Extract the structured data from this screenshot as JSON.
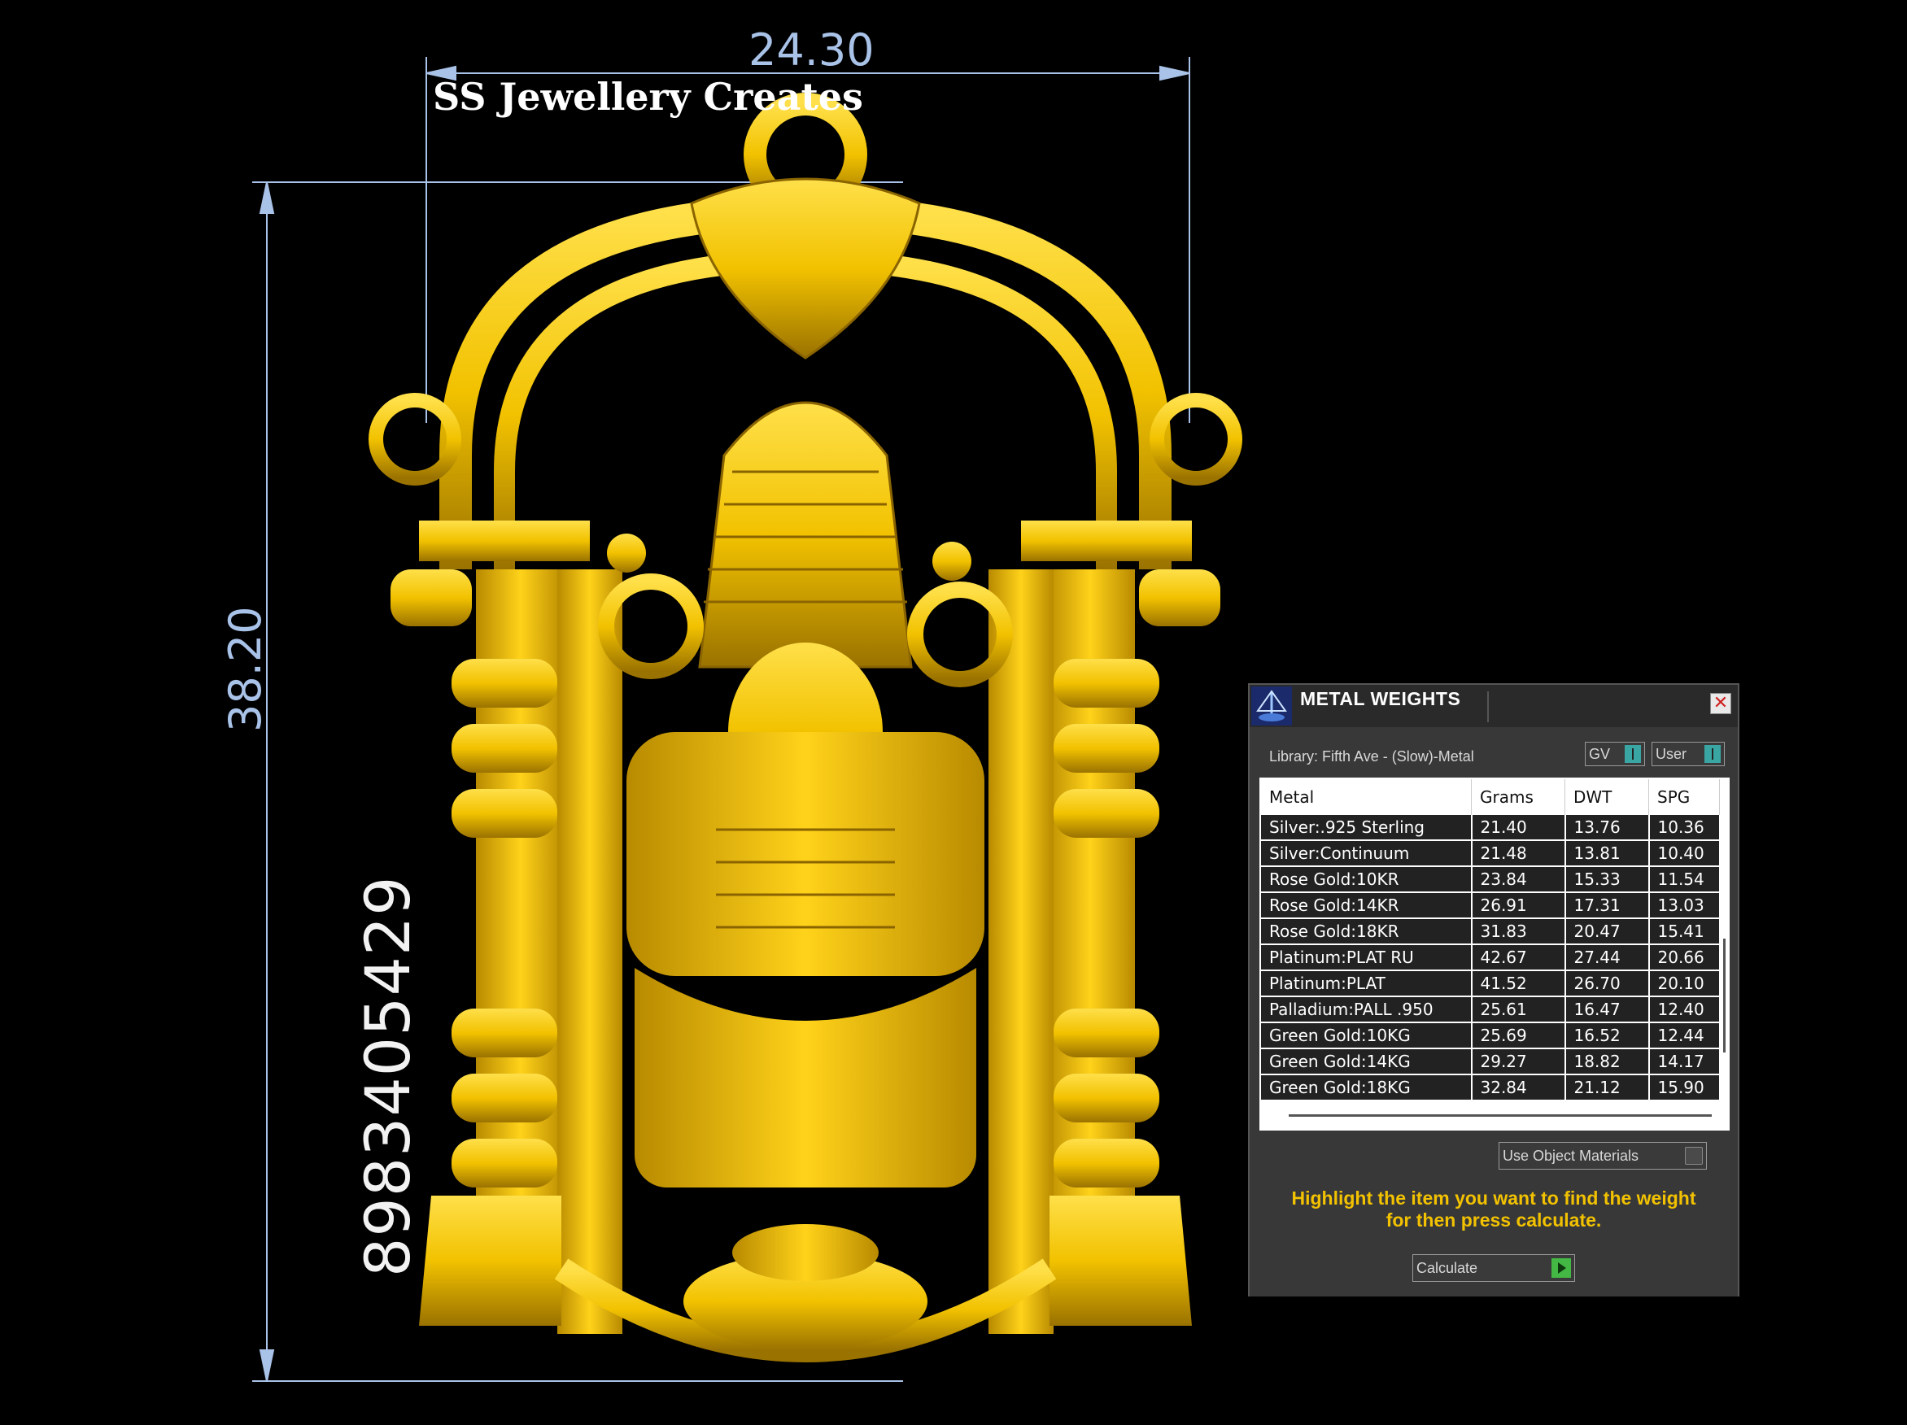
{
  "viewport": {
    "dimension_width": "24.30",
    "dimension_height": "38.20",
    "phone": "8983405429",
    "brand": "SS Jewellery Creates",
    "model_color": "#f2c200",
    "dimension_color": "#a9c2e8"
  },
  "panel": {
    "title": "METAL WEIGHTS",
    "close_icon": "close-icon",
    "library": "Library: Fifth Ave - (Slow)-Metal",
    "toggles": [
      {
        "label": "GV"
      },
      {
        "label": "User"
      }
    ],
    "table": {
      "headers": [
        "Metal",
        "Grams",
        "DWT",
        "SPG"
      ],
      "rows": [
        [
          "Silver:.925 Sterling",
          "21.40",
          "13.76",
          "10.36"
        ],
        [
          "Silver:Continuum",
          "21.48",
          "13.81",
          "10.40"
        ],
        [
          "Rose Gold:10KR",
          "23.84",
          "15.33",
          "11.54"
        ],
        [
          "Rose Gold:14KR",
          "26.91",
          "17.31",
          "13.03"
        ],
        [
          "Rose Gold:18KR",
          "31.83",
          "20.47",
          "15.41"
        ],
        [
          "Platinum:PLAT RU",
          "42.67",
          "27.44",
          "20.66"
        ],
        [
          "Platinum:PLAT",
          "41.52",
          "26.70",
          "20.10"
        ],
        [
          "Palladium:PALL .950",
          "25.61",
          "16.47",
          "12.40"
        ],
        [
          "Green Gold:10KG",
          "25.69",
          "16.52",
          "12.44"
        ],
        [
          "Green Gold:14KG",
          "29.27",
          "18.82",
          "14.17"
        ],
        [
          "Green Gold:18KG",
          "32.84",
          "21.12",
          "15.90"
        ]
      ]
    },
    "use_object_materials": "Use Object Materials",
    "instructions_line1": "Highlight the item you want to find the weight",
    "instructions_line2": "for then press calculate.",
    "calculate": "Calculate",
    "accent_color": "#f2c200"
  }
}
